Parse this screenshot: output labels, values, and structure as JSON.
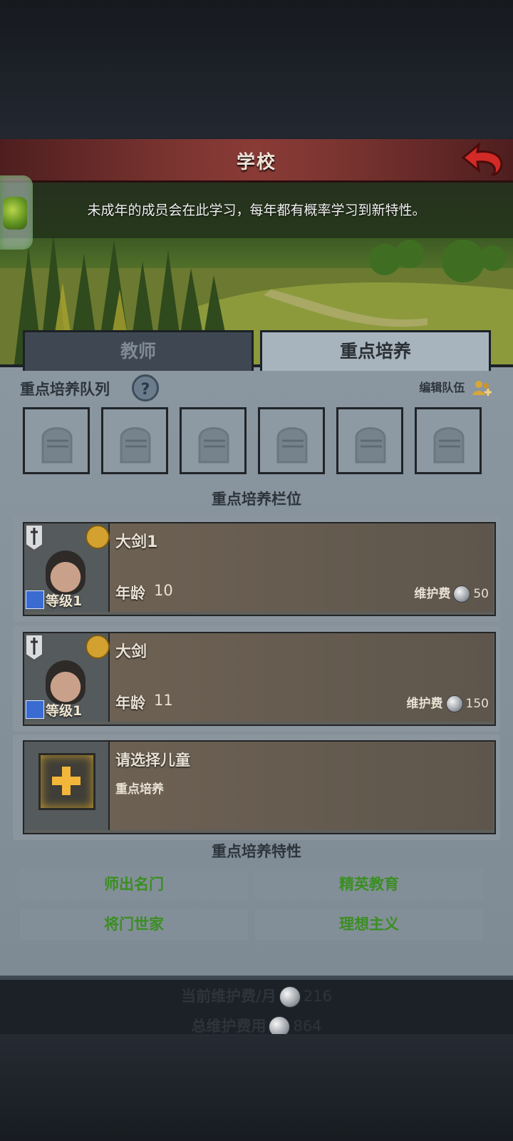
{
  "header": {
    "title": "学校"
  },
  "banner": {
    "description": "未成年的成员会在此学习，每年都有概率学习到新特性。"
  },
  "tabs": [
    {
      "label": "教师"
    },
    {
      "label": "重点培养"
    }
  ],
  "queue": {
    "title": "重点培养队列",
    "help": "?",
    "edit_label": "编辑队伍"
  },
  "slots_title": "重点培养栏位",
  "cards": [
    {
      "name": "大剑1",
      "level": "等级1",
      "age_label": "年龄",
      "age": "10",
      "upkeep_label": "维护费",
      "upkeep": "50"
    },
    {
      "name": "大剑",
      "level": "等级1",
      "age_label": "年龄",
      "age": "11",
      "upkeep_label": "维护费",
      "upkeep": "150"
    }
  ],
  "empty_slot": {
    "title": "请选择儿童",
    "subtitle": "重点培养"
  },
  "traits_title": "重点培养特性",
  "traits": [
    "师出名门",
    "精英教育",
    "将门世家",
    "理想主义"
  ],
  "footer": {
    "monthly_label": "当前维护费/月",
    "monthly_value": "216",
    "total_label": "总维护费用",
    "total_value": "864"
  },
  "colors": {
    "header": "#7c3531",
    "trait_text": "#3b8e22",
    "tab_active": "#a8b4bd"
  }
}
